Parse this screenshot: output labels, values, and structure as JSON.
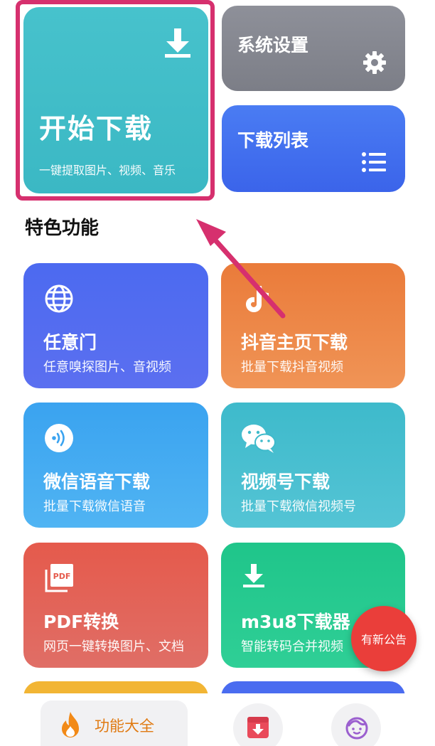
{
  "top": {
    "start": {
      "title": "开始下载",
      "subtitle": "一键提取图片、视频、音乐",
      "icon": "download-icon"
    },
    "settings": {
      "title": "系统设置",
      "icon": "gear-icon"
    },
    "list": {
      "title": "下载列表",
      "icon": "list-icon"
    }
  },
  "section_title": "特色功能",
  "features": [
    {
      "title": "任意门",
      "subtitle": "任意嗅探图片、音视频",
      "icon": "globe-icon",
      "color": "#4c6af0"
    },
    {
      "title": "抖音主页下载",
      "subtitle": "批量下载抖音视频",
      "icon": "tiktok-icon",
      "color": "#ea7b3a"
    },
    {
      "title": "微信语音下载",
      "subtitle": "批量下载微信语音",
      "icon": "voice-icon",
      "color": "#3aa3f0"
    },
    {
      "title": "视频号下载",
      "subtitle": "批量下载微信视频号",
      "icon": "wechat-icon",
      "color": "#3ebacb"
    },
    {
      "title": "PDF转换",
      "subtitle": "网页一键转换图片、文档",
      "icon": "pdf-icon",
      "color": "#e55a4c"
    },
    {
      "title": "m3u8下载器",
      "subtitle": "智能转码合并视频",
      "icon": "download-icon",
      "color": "#1fc58a"
    }
  ],
  "notice": {
    "label": "有新公告",
    "color": "#ea3e3a"
  },
  "bottom_nav": {
    "all": {
      "label": "功能大全",
      "icon": "flame-icon",
      "color": "#e07a12"
    },
    "download": {
      "icon": "download-box-icon"
    },
    "me": {
      "icon": "face-icon"
    }
  },
  "highlight_color": "#d6306e"
}
